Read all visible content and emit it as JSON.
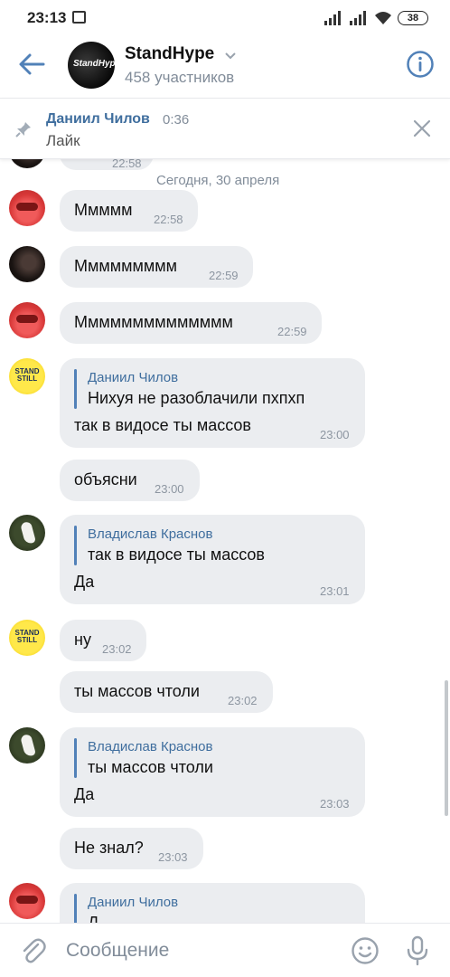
{
  "status_bar": {
    "time": "23:13",
    "battery": "38"
  },
  "header": {
    "title": "StandHype",
    "subtitle": "458 участников",
    "avatar_text": "StandHype"
  },
  "pinned": {
    "author": "Даниил Чилов",
    "time": "0:36",
    "text": "Лайк"
  },
  "messages": {
    "partial_top": {
      "text": "...",
      "time": "22:58"
    },
    "date_separator": "Сегодня, 30 апреля",
    "items": [
      {
        "text": "Ммммм",
        "time": "22:58"
      },
      {
        "text": "Ммммммммм",
        "time": "22:59"
      },
      {
        "text": "Мммммммммммммм",
        "time": "22:59"
      },
      {
        "reply_author": "Даниил Чилов",
        "reply_text": "Нихуя не разоблачили пхпхп",
        "text": "так в видосе ты массов",
        "time": "23:00"
      },
      {
        "text": "объясни",
        "time": "23:00"
      },
      {
        "reply_author": "Владислав Краснов",
        "reply_text": "так в видосе ты массов",
        "text": "Да",
        "time": "23:01"
      },
      {
        "text": "ну",
        "time": "23:02"
      },
      {
        "text": "ты массов чтоли",
        "time": "23:02"
      },
      {
        "reply_author": "Владислав Краснов",
        "reply_text": "ты массов чтоли",
        "text": "Да",
        "time": "23:03"
      },
      {
        "text": "Не знал?",
        "time": "23:03"
      },
      {
        "reply_author": "Даниил Чилов",
        "reply_text": "Д"
      }
    ],
    "avatar_labels": {
      "yellow": "STAND STILL"
    }
  },
  "composer": {
    "placeholder": "Сообщение"
  },
  "colors": {
    "accent": "#5181b8",
    "bubble": "#ebedf0",
    "secondary_text": "#818c99"
  },
  "icons": [
    "back-arrow-icon",
    "chevron-down-icon",
    "info-icon",
    "pin-icon",
    "close-icon",
    "paperclip-icon",
    "smile-icon",
    "microphone-icon"
  ]
}
